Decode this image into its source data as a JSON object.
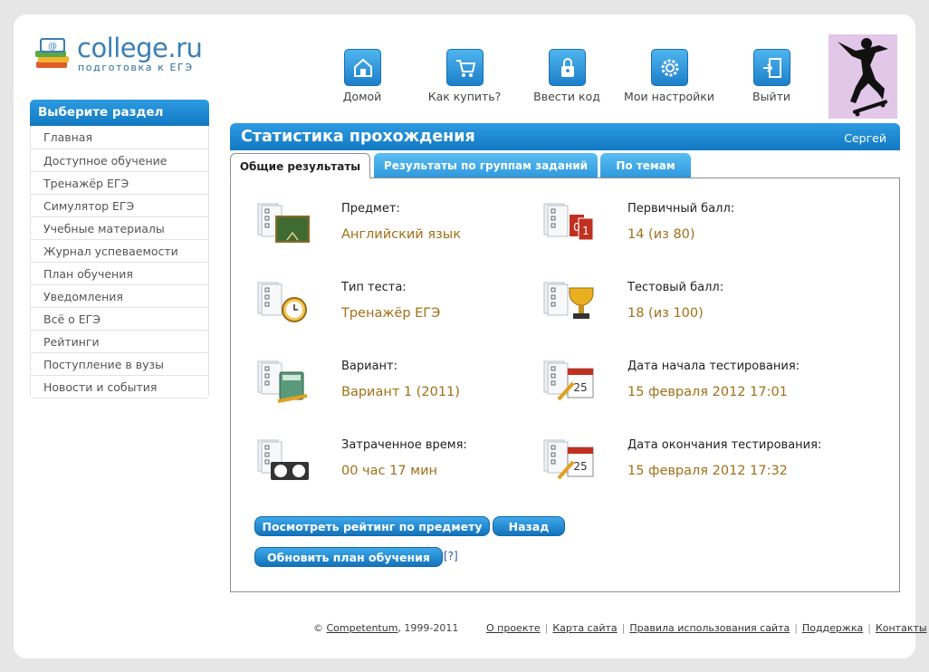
{
  "logo": {
    "name": "college.ru",
    "tagline": "подготовка к ЕГЭ"
  },
  "topnav": [
    {
      "label": "Домой",
      "icon": "home-icon"
    },
    {
      "label": "Как купить?",
      "icon": "cart-icon"
    },
    {
      "label": "Ввести код",
      "icon": "lock-icon"
    },
    {
      "label": "Мои настройки",
      "icon": "gear-icon"
    },
    {
      "label": "Выйти",
      "icon": "exit-door-icon"
    }
  ],
  "sidebar": {
    "title": "Выберите раздел",
    "items": [
      "Главная",
      "Доступное обучение",
      "Тренажёр ЕГЭ",
      "Симулятор ЕГЭ",
      "Учебные материалы",
      "Журнал успеваемости",
      "План обучения",
      "Уведомления",
      "Всё о ЕГЭ",
      "Рейтинги",
      "Поступление в вузы",
      "Новости и события"
    ]
  },
  "panel": {
    "title": "Статистика прохождения",
    "user": "Сергей"
  },
  "tabs": [
    "Общие результаты",
    "Результаты по группам заданий",
    "По темам"
  ],
  "stats": {
    "subject": {
      "label": "Предмет:",
      "value": "Английский язык",
      "icon": "blackboard-icon"
    },
    "test_type": {
      "label": "Тип теста:",
      "value": "Тренажёр ЕГЭ",
      "icon": "alarm-clock-icon"
    },
    "variant": {
      "label": "Вариант:",
      "value": "Вариант 1 (2011)",
      "icon": "calculator-icon"
    },
    "time_spent": {
      "label": "Затраченное время:",
      "value": "00 час 17 мин",
      "icon": "chess-clock-icon"
    },
    "primary_score": {
      "label": "Первичный балл:",
      "value": "14 (из 80)",
      "icon": "score-cards-icon"
    },
    "test_score": {
      "label": "Тестовый балл:",
      "value": "18 (из 100)",
      "icon": "trophy-icon"
    },
    "start_date": {
      "label": "Дата начала тестирования:",
      "value": "15 февраля 2012 17:01",
      "icon": "calendar-icon"
    },
    "end_date": {
      "label": "Дата окончания тестирования:",
      "value": "15 февраля 2012 17:32",
      "icon": "calendar-icon"
    }
  },
  "calendar_day": "25",
  "score_digits": "01",
  "buttons": {
    "rating": "Посмотреть рейтинг по предмету",
    "back": "Назад",
    "update_plan": "Обновить план обучения",
    "help": "[?]"
  },
  "footer": {
    "copyright_prefix": "©",
    "company": "Competentum",
    "years": ", 1999-2011",
    "links": [
      "О проекте",
      "Карта сайта",
      "Правила использования сайта",
      "Поддержка",
      "Контакты"
    ]
  },
  "colors": {
    "accent_blue": "#1c86d1",
    "value_gold": "#a07018",
    "background": "#e6e6e6"
  }
}
